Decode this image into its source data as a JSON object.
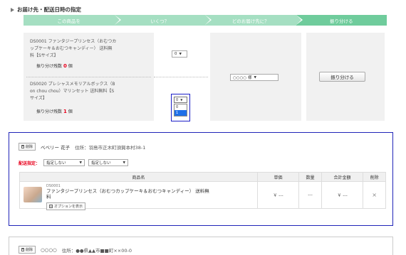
{
  "section": {
    "title": "お届け先・配送日時の指定"
  },
  "steps": [
    "この商品を",
    "いくつ？",
    "どのお届け先に？",
    "振り分ける"
  ],
  "products": [
    {
      "description": "DS0001 ファンタジープリンセス（おむつカップケーキ＆おむつキャンディー） 送料無料【Sサイズ】",
      "lines": [
        "DS0001 ファンタジープリンセス（おむつカ",
        "ップケーキ＆おむつキャンディー） 送料無",
        "料【Sサイズ】"
      ],
      "alloc_label": "振り分け残数",
      "alloc_count": "0",
      "alloc_unit": "個",
      "qty_value": "0"
    },
    {
      "description": "DS0020 プレシャスメモリアルボックス（Bon chou chou）マリンセット 送料無料【Sサイズ】",
      "lines": [
        "DS0020 プレシャスメモリアルボックス（B",
        "on chou chou）マリンセット 送料無料【S",
        "サイズ】"
      ],
      "alloc_label": "振り分け残数",
      "alloc_count": "1",
      "alloc_unit": "個",
      "qty_value": "0",
      "qty_options": [
        "0",
        "1"
      ]
    }
  ],
  "destination_select": {
    "value": "○○○○ 様"
  },
  "allocate_button": "振り分ける",
  "cards": [
    {
      "delete_label": "削除",
      "name": "ベベリー 花子",
      "address_label": "住所：",
      "address": "羽島市正木町須賀本村38-1",
      "ship_label": "配送指定：",
      "ship_date": "指定しない",
      "ship_time": "指定しない",
      "table_headers": [
        "商品名",
        "単価",
        "数量",
        "合計金額",
        "削除"
      ],
      "item": {
        "code": "DS0001",
        "name": "ファンタジープリンセス（おむつカップケーキ＆おむつキャンディー） 送料無料",
        "option_button": "オプションを表示",
        "unit_price": "￥ ---",
        "qty": "---",
        "total": "￥ ---",
        "remove": "×"
      }
    },
    {
      "delete_label": "削除",
      "name": "○○○○",
      "address_label": "住所：",
      "address": "●●県▲▲市■■町××00-0"
    }
  ],
  "colors": {
    "step": "#a5dfc2",
    "step_active": "#6fcc9c",
    "alert": "#e8001c",
    "focus": "#2024b8"
  }
}
